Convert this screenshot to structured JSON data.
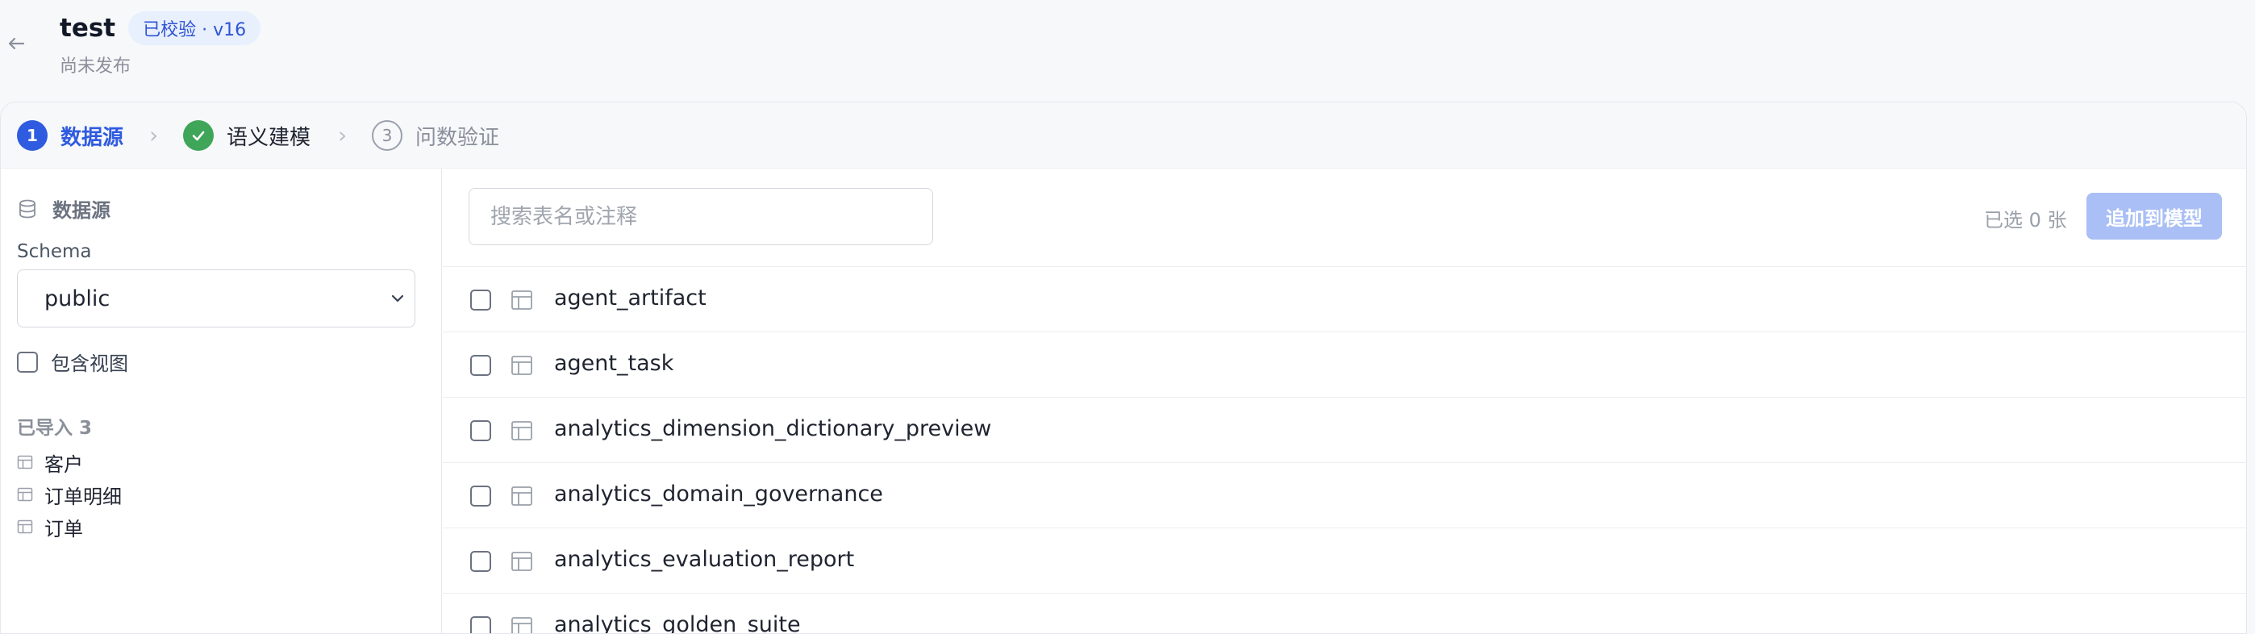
{
  "header": {
    "title": "test",
    "badge": "已校验 · v16",
    "subtitle": "尚未发布"
  },
  "stepper": {
    "steps": [
      {
        "number": "1",
        "label": "数据源",
        "state": "active"
      },
      {
        "number": "",
        "label": "语义建模",
        "state": "done"
      },
      {
        "number": "3",
        "label": "问数验证",
        "state": "todo"
      }
    ],
    "separator": "›"
  },
  "sidebar": {
    "section_title": "数据源",
    "schema_label": "Schema",
    "schema_value": "public",
    "include_views_label": "包含视图",
    "imported_title": "已导入 3",
    "imported_items": [
      "客户",
      "订单明细",
      "订单"
    ]
  },
  "main": {
    "search_placeholder": "搜索表名或注释",
    "selected_count": "已选 0 张",
    "add_button": "追加到模型",
    "tables": [
      "agent_artifact",
      "agent_task",
      "analytics_dimension_dictionary_preview",
      "analytics_domain_governance",
      "analytics_evaluation_report",
      "analytics_golden_suite"
    ]
  },
  "colors": {
    "accent": "#2f5be0",
    "success": "#3ea559",
    "badge_bg": "#e8effd",
    "disabled_button": "#a9bff5"
  }
}
